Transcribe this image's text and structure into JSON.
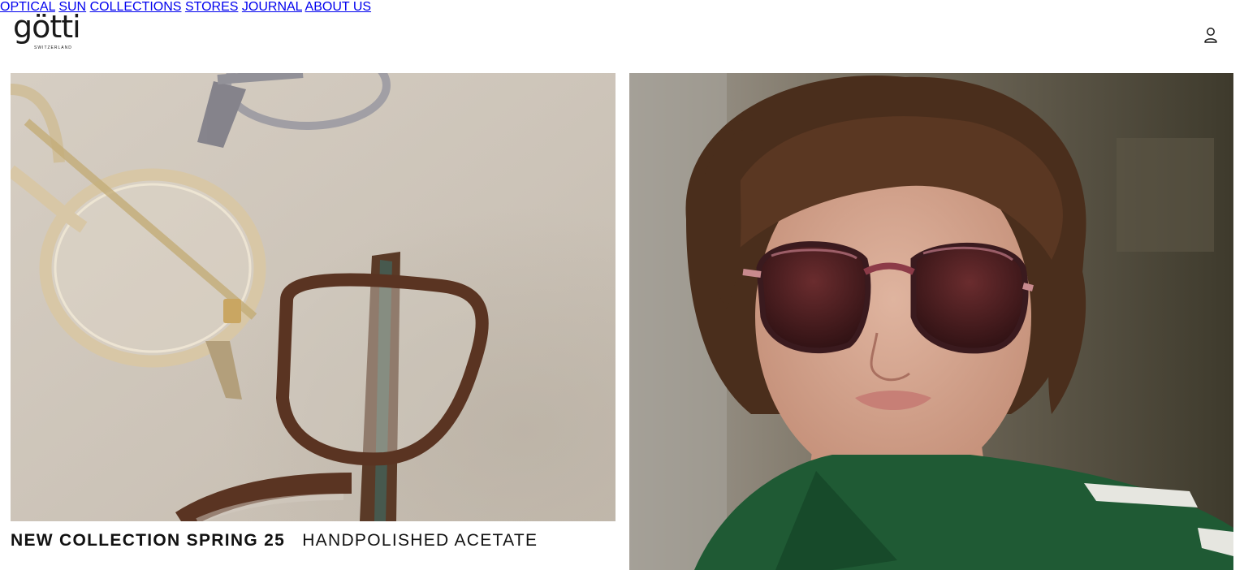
{
  "brand": {
    "name": "götti",
    "tagline": "SWITZERLAND"
  },
  "nav": {
    "items": [
      {
        "label": "OPTICAL"
      },
      {
        "label": "SUN"
      },
      {
        "label": "COLLECTIONS"
      },
      {
        "label": "STORES"
      },
      {
        "label": "JOURNAL"
      },
      {
        "label": "ABOUT US"
      }
    ],
    "account_icon": "user-icon"
  },
  "hero": {
    "left_image": "eyeglasses-on-felt-photo",
    "right_image": "model-wearing-sunglasses-photo",
    "caption_primary": "NEW COLLECTION SPRING 25",
    "caption_secondary": "HANDPOLISHED ACETATE"
  },
  "colors": {
    "text": "#111111",
    "background": "#ffffff"
  }
}
